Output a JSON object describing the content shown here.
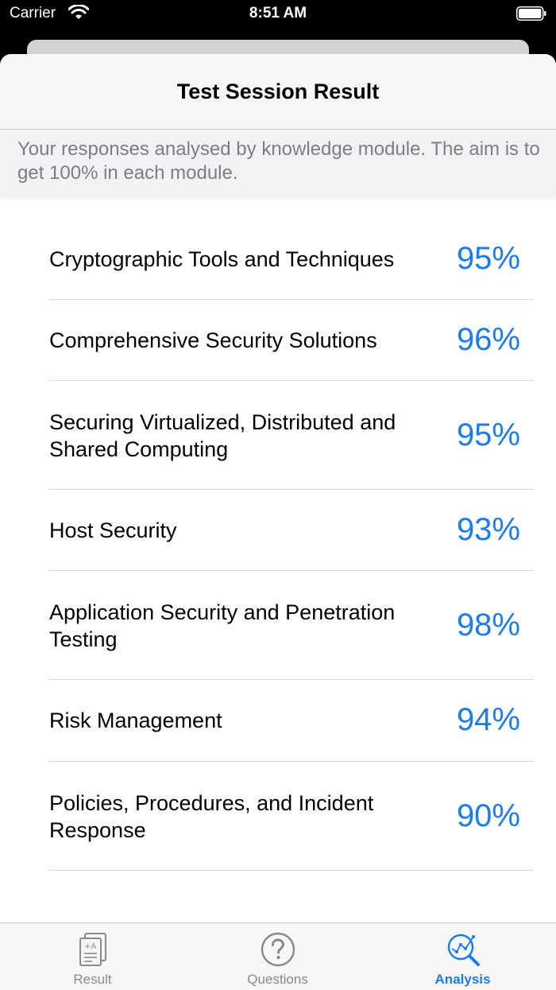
{
  "status": {
    "carrier": "Carrier",
    "time": "8:51 AM"
  },
  "header": {
    "title": "Test Session Result",
    "subtitle": "Your responses analysed by knowledge module. The aim is to get 100% in each module."
  },
  "modules": [
    {
      "name": "Cryptographic Tools and Techniques",
      "score": "95%"
    },
    {
      "name": "Comprehensive Security Solutions",
      "score": "96%"
    },
    {
      "name": "Securing Virtualized, Distributed and Shared Computing",
      "score": "95%"
    },
    {
      "name": "Host Security",
      "score": "93%"
    },
    {
      "name": "Application Security and Penetration Testing",
      "score": "98%"
    },
    {
      "name": "Risk Management",
      "score": "94%"
    },
    {
      "name": "Policies, Procedures, and Incident Response",
      "score": "90%"
    }
  ],
  "tabs": [
    {
      "label": "Result",
      "icon": "document-icon"
    },
    {
      "label": "Questions",
      "icon": "question-icon"
    },
    {
      "label": "Analysis",
      "icon": "analysis-icon"
    }
  ],
  "colors": {
    "accent": "#1a7cf0",
    "inactive": "#8a8a8e"
  }
}
